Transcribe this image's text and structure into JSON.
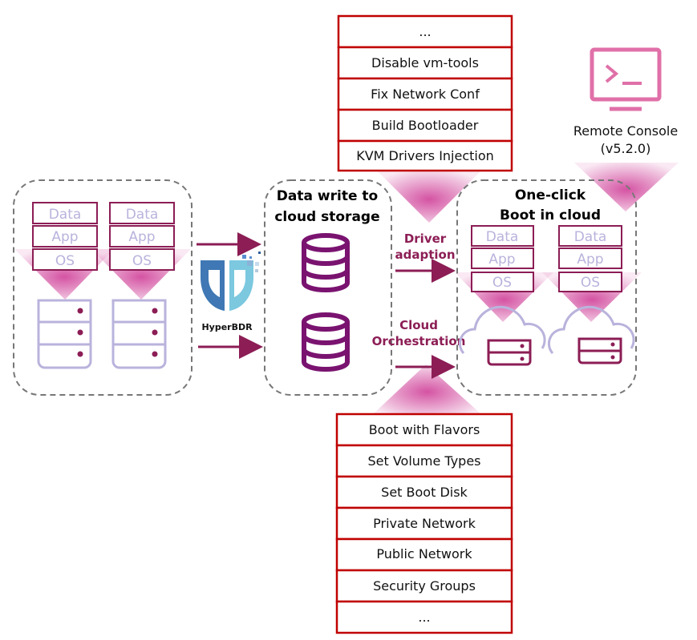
{
  "colors": {
    "accent": "#8c1d55",
    "list_border": "#c00000",
    "layer_text": "#b9b3dc",
    "funnel": "#d957a8",
    "console": "#e070a8"
  },
  "source": {
    "layers": [
      "Data",
      "App",
      "OS"
    ],
    "servers": 2
  },
  "logo": {
    "name": "HyperBDR"
  },
  "storage": {
    "title_line1": "Data write to",
    "title_line2": "cloud storage"
  },
  "driver": {
    "line1": "Driver",
    "line2": "adaption",
    "steps": [
      "...",
      "Disable vm-tools",
      "Fix Network Conf",
      "Build Bootloader",
      "KVM Drivers Injection"
    ]
  },
  "orchestration": {
    "line1": "Cloud",
    "line2": "Orchestration",
    "steps": [
      "Boot with Flavors",
      "Set Volume Types",
      "Set Boot Disk",
      "Private Network",
      "Public Network",
      "Security Groups",
      "..."
    ]
  },
  "target": {
    "title_line1": "One-click",
    "title_line2": "Boot in cloud",
    "layers": [
      "Data",
      "App",
      "OS"
    ]
  },
  "console": {
    "label": "Remote Console",
    "version": "(v5.2.0)"
  }
}
